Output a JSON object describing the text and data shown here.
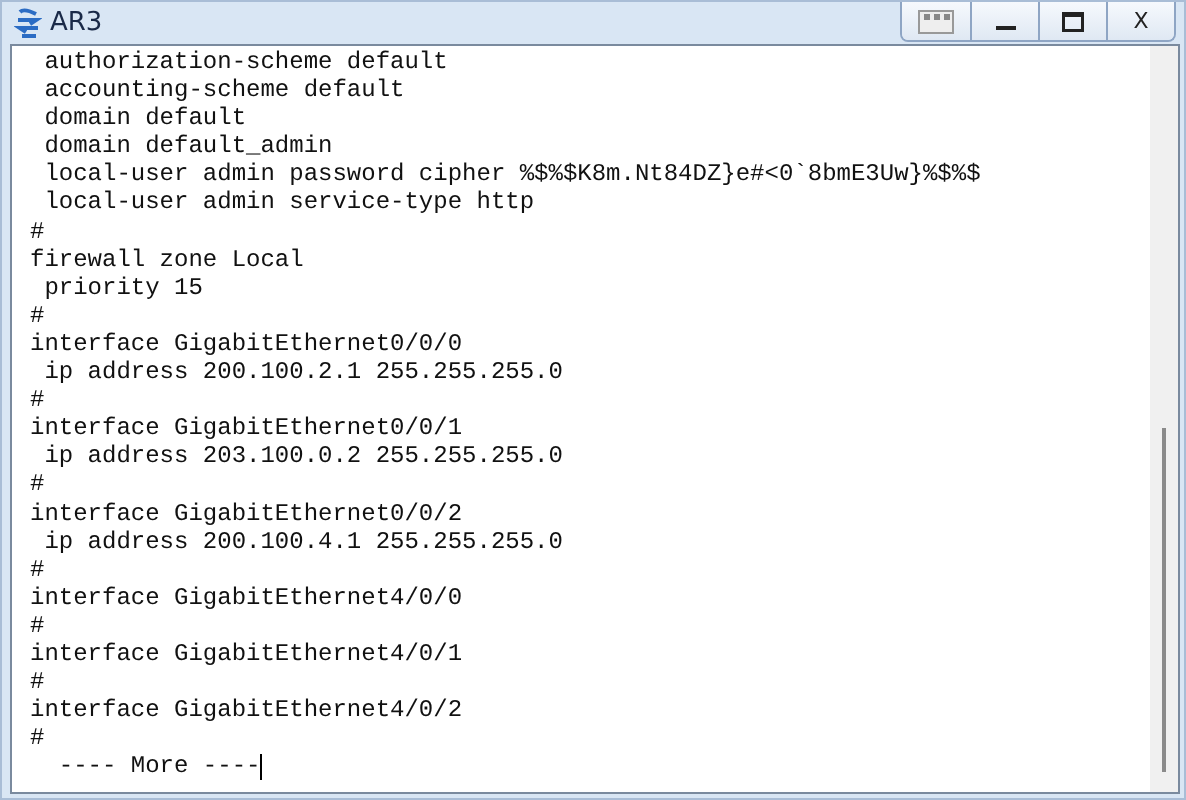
{
  "window": {
    "title": "AR3",
    "close_label": "X"
  },
  "terminal": {
    "lines": [
      " authorization-scheme default",
      " accounting-scheme default",
      " domain default",
      " domain default_admin",
      " local-user admin password cipher %$%$K8m.Nt84DZ}e#<0`8bmE3Uw}%$%$",
      " local-user admin service-type http",
      "#",
      "firewall zone Local",
      " priority 15",
      "#",
      "interface GigabitEthernet0/0/0",
      " ip address 200.100.2.1 255.255.255.0",
      "#",
      "interface GigabitEthernet0/0/1",
      " ip address 203.100.0.2 255.255.255.0",
      "#",
      "interface GigabitEthernet0/0/2",
      " ip address 200.100.4.1 255.255.255.0",
      "#",
      "interface GigabitEthernet4/0/0",
      "#",
      "interface GigabitEthernet4/0/1",
      "#",
      "interface GigabitEthernet4/0/2",
      "#"
    ],
    "prompt": "  ---- More ----"
  }
}
